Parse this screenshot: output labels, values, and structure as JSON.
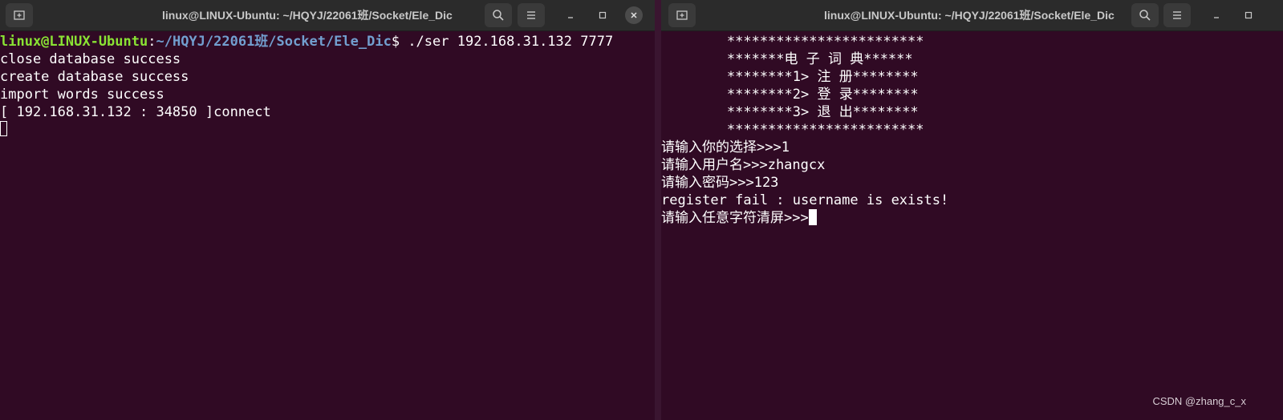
{
  "left_window": {
    "title": "linux@LINUX-Ubuntu: ~/HQYJ/22061班/Socket/Ele_Dic",
    "new_tab_icon": "new-tab-icon",
    "search_icon": "search-icon",
    "menu_icon": "hamburger-menu-icon",
    "prompt": {
      "user_host": "linux@LINUX-Ubuntu",
      "separator": ":",
      "path": "~/HQYJ/22061班/Socket/Ele_Dic",
      "symbol": "$",
      "command": " ./ser 192.168.31.132 7777"
    },
    "output": [
      "close database success",
      "create database success",
      "import words success",
      "[ 192.168.31.132 : 34850 ]connect"
    ]
  },
  "right_window": {
    "title": "linux@LINUX-Ubuntu: ~/HQYJ/22061班/Socket/Ele_Dic",
    "menu_lines": [
      "        ************************",
      "        *******电 子 词 典******",
      "        ********1> 注 册********",
      "        ********2> 登 录********",
      "        ********3> 退 出********",
      "        ************************"
    ],
    "session": [
      "请输入你的选择>>>1",
      "请输入用户名>>>zhangcx",
      "请输入密码>>>123",
      "register fail : username is exists!"
    ],
    "final_prompt": "请输入任意字符清屏>>>"
  },
  "watermark": "CSDN @zhang_c_x"
}
